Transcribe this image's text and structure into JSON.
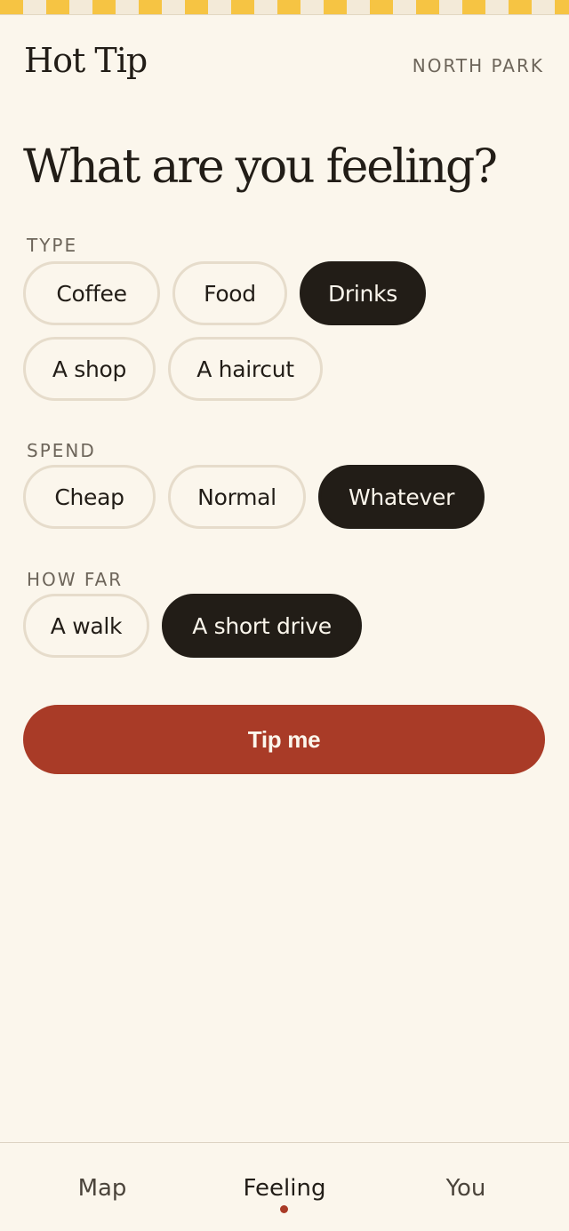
{
  "header": {
    "brand": "Hot Tip",
    "location": "NORTH PARK"
  },
  "headline": "What are you feeling?",
  "sections": {
    "type": {
      "label": "TYPE",
      "options": [
        "Coffee",
        "Food",
        "Drinks",
        "A shop",
        "A haircut"
      ],
      "selected": "Drinks"
    },
    "spend": {
      "label": "SPEND",
      "options": [
        "Cheap",
        "Normal",
        "Whatever"
      ],
      "selected": "Whatever"
    },
    "distance": {
      "label": "HOW FAR",
      "options": [
        "A walk",
        "A short drive"
      ],
      "selected": "A short drive"
    }
  },
  "cta": {
    "label": "Tip me"
  },
  "bottom_nav": {
    "items": [
      "Map",
      "Feeling",
      "You"
    ],
    "active": "Feeling"
  },
  "colors": {
    "background": "#fbf6ec",
    "ink": "#221d17",
    "accent": "#a93b27",
    "stripe": "#f6c443"
  }
}
